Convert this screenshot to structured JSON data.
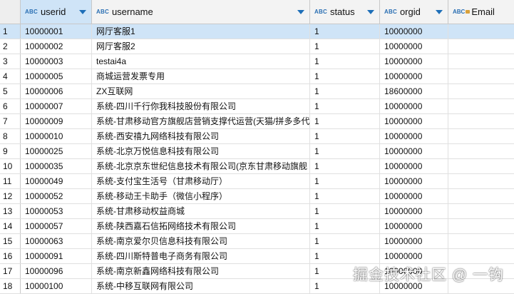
{
  "columns": [
    {
      "key": "userid",
      "label": "userid",
      "type_badge": "ABC",
      "sortable": true,
      "active": true
    },
    {
      "key": "username",
      "label": "username",
      "type_badge": "ABC",
      "sortable": true,
      "active": false
    },
    {
      "key": "status",
      "label": "status",
      "type_badge": "ABC",
      "sortable": true,
      "active": false
    },
    {
      "key": "orgid",
      "label": "orgid",
      "type_badge": "ABC",
      "sortable": true,
      "active": false
    },
    {
      "key": "email",
      "label": "Email",
      "type_badge": "ABC",
      "sortable": false,
      "active": false
    }
  ],
  "rows": [
    {
      "n": "1",
      "userid": "10000001",
      "username": "网厅客服1",
      "status": "1",
      "orgid": "10000000",
      "email": "",
      "selected": true
    },
    {
      "n": "2",
      "userid": "10000002",
      "username": "网厅客服2",
      "status": "1",
      "orgid": "10000000",
      "email": ""
    },
    {
      "n": "3",
      "userid": "10000003",
      "username": "testai4a",
      "status": "1",
      "orgid": "10000000",
      "email": ""
    },
    {
      "n": "4",
      "userid": "10000005",
      "username": "商城运营发票专用",
      "status": "1",
      "orgid": "10000000",
      "email": ""
    },
    {
      "n": "5",
      "userid": "10000006",
      "username": "ZX互联网",
      "status": "1",
      "orgid": "18600000",
      "email": ""
    },
    {
      "n": "6",
      "userid": "10000007",
      "username": "系统-四川千行你我科技股份有限公司",
      "status": "1",
      "orgid": "10000000",
      "email": ""
    },
    {
      "n": "7",
      "userid": "10000009",
      "username": "系统-甘肃移动官方旗舰店营销支撑代运营(天猫/拼多多代",
      "status": "1",
      "orgid": "10000000",
      "email": ""
    },
    {
      "n": "8",
      "userid": "10000010",
      "username": "系统-西安禧九网络科技有限公司",
      "status": "1",
      "orgid": "10000000",
      "email": ""
    },
    {
      "n": "9",
      "userid": "10000025",
      "username": "系统-北京万悦信息科技有限公司",
      "status": "1",
      "orgid": "10000000",
      "email": ""
    },
    {
      "n": "10",
      "userid": "10000035",
      "username": "系统-北京京东世纪信息技术有限公司(京东甘肃移动旗舰",
      "status": "1",
      "orgid": "10000000",
      "email": ""
    },
    {
      "n": "11",
      "userid": "10000049",
      "username": "系统-支付宝生活号（甘肃移动厅）",
      "status": "1",
      "orgid": "10000000",
      "email": ""
    },
    {
      "n": "12",
      "userid": "10000052",
      "username": "系统-移动王卡助手（微信小程序）",
      "status": "1",
      "orgid": "10000000",
      "email": ""
    },
    {
      "n": "13",
      "userid": "10000053",
      "username": "系统-甘肃移动权益商城",
      "status": "1",
      "orgid": "10000000",
      "email": ""
    },
    {
      "n": "14",
      "userid": "10000057",
      "username": "系统-陕西嘉石信拓网络技术有限公司",
      "status": "1",
      "orgid": "10000000",
      "email": ""
    },
    {
      "n": "15",
      "userid": "10000063",
      "username": "系统-南京爱尔贝信息科技有限公司",
      "status": "1",
      "orgid": "10000000",
      "email": ""
    },
    {
      "n": "16",
      "userid": "10000091",
      "username": "系统-四川斯特普电子商务有限公司",
      "status": "1",
      "orgid": "10000000",
      "email": ""
    },
    {
      "n": "17",
      "userid": "10000096",
      "username": "系统-南京新鑫网络科技有限公司",
      "status": "1",
      "orgid": "10000000",
      "email": ""
    },
    {
      "n": "18",
      "userid": "10000100",
      "username": "系统-中移互联网有限公司",
      "status": "1",
      "orgid": "10000000",
      "email": ""
    }
  ],
  "watermark": "掘金技术社区 @ 一钩",
  "colors": {
    "selection": "#cfe4f7",
    "header_bg": "#f3f3f3",
    "type_badge": "#2a6fb3",
    "sort_arrow": "#1e6fb8"
  }
}
